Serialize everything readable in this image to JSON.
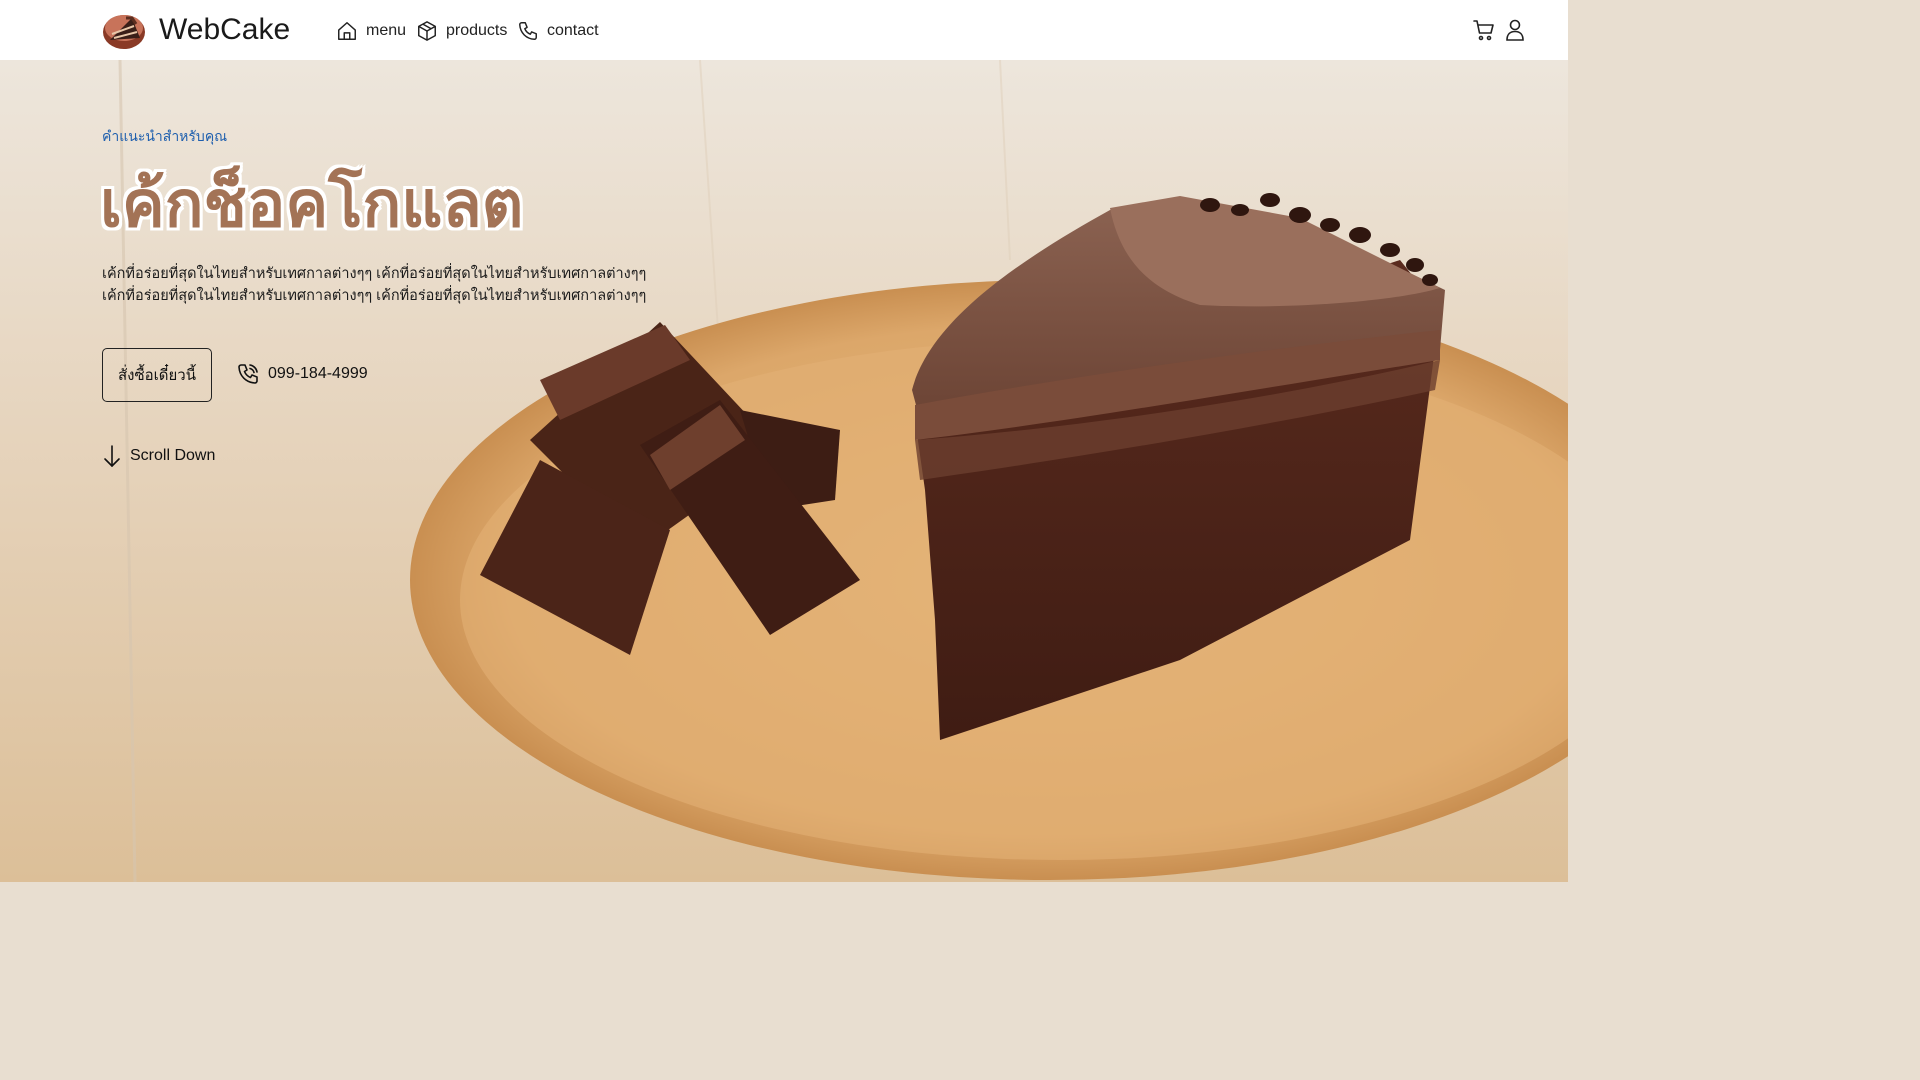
{
  "header": {
    "logo_icon": "cake-slice-logo-icon",
    "brand": "WebCake",
    "nav": [
      {
        "label": "menu",
        "icon": "home-icon"
      },
      {
        "label": "products",
        "icon": "box-icon"
      },
      {
        "label": "contact",
        "icon": "phone-icon"
      }
    ],
    "cart_icon": "cart-icon",
    "user_icon": "user-icon"
  },
  "hero": {
    "tagline": "คำแนะนำสำหรับคุณ",
    "title": "เค้กช็อคโกแลต",
    "description_line1": "เค้กที่อร่อยที่สุดในไทยสำหรับเทศกาลต่างๆๆ เค้กที่อร่อยที่สุดในไทยสำหรับเทศกาลต่างๆๆ",
    "description_line2": "เค้กที่อร่อยที่สุดในไทยสำหรับเทศกาลต่างๆๆ เค้กที่อร่อยที่สุดในไทยสำหรับเทศกาลต่างๆๆ",
    "order_button": "สั่งซื้อเดี๋ยวนี้",
    "phone": "099-184-4999",
    "scroll_label": "Scroll Down",
    "image_subject": "chocolate-cake-slice-photo"
  },
  "colors": {
    "title": "#a37356",
    "tagline": "#1f5fae",
    "header_bg": "#ffffff",
    "wood_bg": "#e8ded0"
  }
}
